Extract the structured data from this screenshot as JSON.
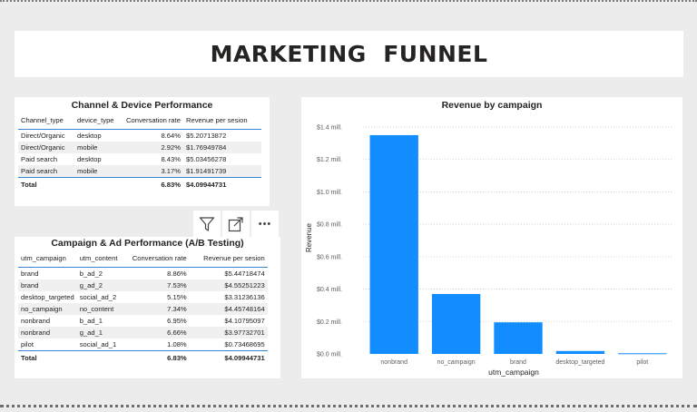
{
  "page_title": "MARKETING  FUNNEL",
  "channel_table": {
    "title": "Channel & Device Performance",
    "headers": [
      "Channel_type",
      "device_type",
      "Conversation rate",
      "Revenue per sesion"
    ],
    "rows": [
      [
        "Direct/Organic",
        "desktop",
        "8.64%",
        "$5.20713872"
      ],
      [
        "Direct/Organic",
        "mobile",
        "2.92%",
        "$1.76949784"
      ],
      [
        "Paid search",
        "desktop",
        "8.43%",
        "$5.03456278"
      ],
      [
        "Paid search",
        "mobile",
        "3.17%",
        "$1.91491739"
      ]
    ],
    "total": [
      "Total",
      "",
      "6.83%",
      "$4.09944731"
    ]
  },
  "campaign_table": {
    "title": "Campaign & Ad Performance (A/B Testing)",
    "headers": [
      "utm_campaign",
      "utm_content",
      "Conversation rate",
      "Revenue per sesion"
    ],
    "rows": [
      [
        "brand",
        "b_ad_2",
        "8.86%",
        "$5.44718474"
      ],
      [
        "brand",
        "g_ad_2",
        "7.53%",
        "$4.55251223"
      ],
      [
        "desktop_targeted",
        "social_ad_2",
        "5.15%",
        "$3.31236136"
      ],
      [
        "no_campaign",
        "no_content",
        "7.34%",
        "$4.45748164"
      ],
      [
        "nonbrand",
        "b_ad_1",
        "6.95%",
        "$4.10795097"
      ],
      [
        "nonbrand",
        "g_ad_1",
        "6.66%",
        "$3.97732701"
      ],
      [
        "pilot",
        "social_ad_1",
        "1.08%",
        "$0.73468695"
      ]
    ],
    "total": [
      "Total",
      "",
      "6.83%",
      "$4.09944731"
    ]
  },
  "toolbar": {
    "filter_icon": "filter-icon",
    "focus_icon": "focus-mode-icon",
    "more_label": "•••"
  },
  "chart_data": {
    "type": "bar",
    "title": "Revenue by campaign",
    "xlabel": "utm_campaign",
    "ylabel": "Revenue",
    "categories": [
      "nonbrand",
      "no_campaign",
      "brand",
      "desktop_targeted",
      "pilot"
    ],
    "values": [
      1.35,
      0.37,
      0.195,
      0.018,
      0.004
    ],
    "ylim": [
      0,
      1.4
    ],
    "yticks": [
      0,
      0.2,
      0.4,
      0.6,
      0.8,
      1.0,
      1.2,
      1.4
    ],
    "ytick_labels": [
      "$0.0 mill.",
      "$0.2 mill.",
      "$0.4 mill.",
      "$0.6 mill.",
      "$0.8 mill.",
      "$1.0 mill.",
      "$1.2 mill.",
      "$1.4 mill."
    ],
    "bar_color": "#118dff",
    "grid": true,
    "legend": "none"
  }
}
